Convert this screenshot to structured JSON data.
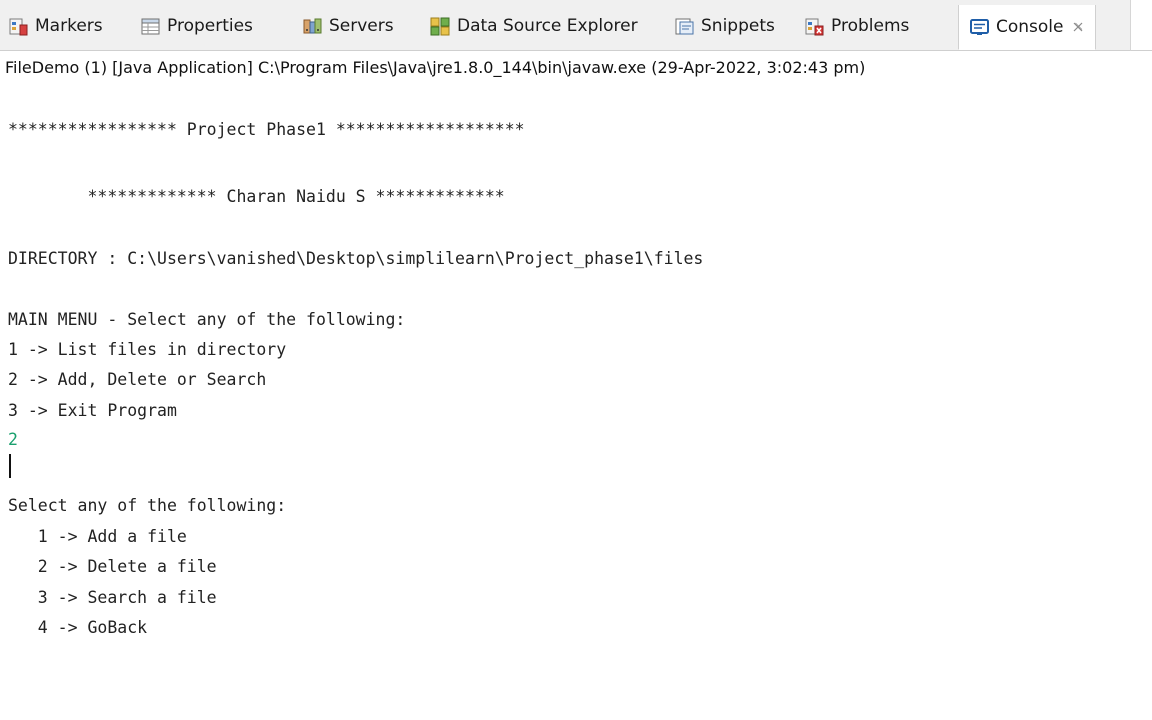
{
  "tabs": [
    {
      "label": "Markers",
      "icon": "markers-icon"
    },
    {
      "label": "Properties",
      "icon": "properties-icon"
    },
    {
      "label": "Servers",
      "icon": "servers-icon"
    },
    {
      "label": "Data Source Explorer",
      "icon": "data-source-explorer-icon"
    },
    {
      "label": "Snippets",
      "icon": "snippets-icon"
    },
    {
      "label": "Problems",
      "icon": "problems-icon"
    },
    {
      "label": "Console",
      "icon": "console-icon",
      "active": true
    }
  ],
  "console": {
    "launch_description": "FileDemo (1) [Java Application] C:\\Program Files\\Java\\jre1.8.0_144\\bin\\javaw.exe (29-Apr-2022, 3:02:43 pm)",
    "lines": [
      "***************** Project Phase1 *******************",
      "        ************* Charan Naidu S *************",
      "DIRECTORY : C:\\Users\\vanished\\Desktop\\simplilearn\\Project_phase1\\files",
      "MAIN MENU - Select any of the following:",
      "1 -> List files in directory",
      "2 -> Add, Delete or Search",
      "3 -> Exit Program",
      "2",
      "Select any of the following:",
      "   1 -> Add a file",
      "   2 -> Delete a file",
      "   3 -> Search a file",
      "   4 -> GoBack"
    ]
  },
  "colors": {
    "user_input": "#1aa06e",
    "output_text": "#222222",
    "tab_strip": "#f0f0f0"
  }
}
